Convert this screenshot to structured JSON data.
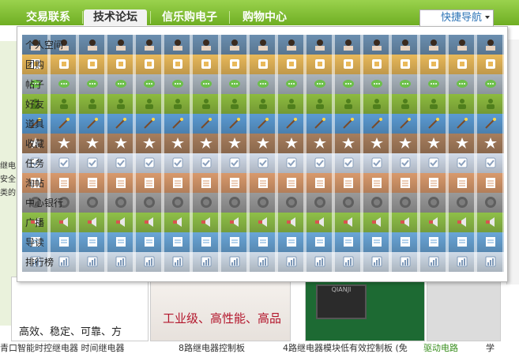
{
  "nav": {
    "tabs": [
      {
        "label": "交易联系"
      },
      {
        "label": "技术论坛",
        "active": true
      },
      {
        "label": "信乐购电子"
      },
      {
        "label": "购物中心"
      }
    ],
    "quick_nav_label": "快捷导航"
  },
  "dropdown": {
    "items": [
      {
        "label": "个人空间",
        "icon": "avatar-icon",
        "color": "#6b8fb0"
      },
      {
        "label": "团购",
        "icon": "group-buy-icon",
        "color": "#e9b95a"
      },
      {
        "label": "帖子",
        "icon": "post-icon",
        "color": "#aab4bd"
      },
      {
        "label": "好友",
        "icon": "friends-icon",
        "color": "#8dbb3f"
      },
      {
        "label": "道具",
        "icon": "magic-wand-icon",
        "color": "#5b9bd3"
      },
      {
        "label": "收藏",
        "icon": "star-icon",
        "color": "#a77e5d"
      },
      {
        "label": "任务",
        "icon": "task-icon",
        "color": "#d2dcea"
      },
      {
        "label": "淘帖",
        "icon": "collection-icon",
        "color": "#d99a6c"
      },
      {
        "label": "中心银行",
        "icon": "coin-icon",
        "color": "#9a9a9a"
      },
      {
        "label": "广播",
        "icon": "broadcast-icon",
        "color": "#8fc048"
      },
      {
        "label": "导读",
        "icon": "guide-icon",
        "color": "#6aa6d8"
      },
      {
        "label": "排行榜",
        "icon": "ranking-icon",
        "color": "#cfdbe8"
      }
    ]
  },
  "background": {
    "left_text": "继电 安全 类的",
    "slogan": "工业级、高性能、高品",
    "tagline": "高效、稳定、可靠、方",
    "chip_text": "QIANJI",
    "captions": [
      "青口智能时控继电器 时间继电器",
      "8路继电器控制板",
      "4路继电器模块低有效控制板 (免",
      "驱动电路",
      "学"
    ]
  },
  "colors": {
    "nav_green": "#7dbb2e",
    "link_blue": "#2d74b6",
    "caption_green": "#3a8f1f"
  }
}
